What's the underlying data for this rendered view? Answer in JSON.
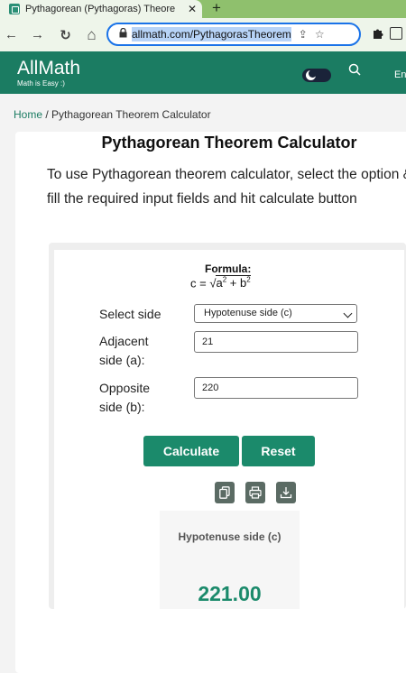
{
  "browser": {
    "tab_title": "Pythagorean (Pythagoras) Theore",
    "close_symbol": "✕",
    "newtab_symbol": "+",
    "url": "allmath.com/PythagorasTheorem",
    "nav": {
      "back": "←",
      "forward": "→",
      "reload": "↻",
      "home": "⌂"
    },
    "omnibox_icons": {
      "share": "⇪",
      "bookmark": "☆"
    },
    "extension_icon": "puzzle-icon"
  },
  "site": {
    "logo": "AllMath",
    "tagline": "Math is Easy :)",
    "lang": "En",
    "accent": "#1b7c62"
  },
  "breadcrumb": {
    "home": "Home",
    "separator": " / ",
    "current": "Pythagorean Theorem Calculator"
  },
  "card": {
    "title": "Pythagorean Theorem Calculator",
    "description": "To use Pythagorean theorem calculator, select the option & fill the required input fields and hit calculate button"
  },
  "calculator": {
    "formula_label": "Formula:",
    "formula": {
      "lhs": "c = ",
      "radical": "√",
      "a": "a",
      "plus": " + ",
      "b": "b",
      "sq": "2"
    },
    "select_label": "Select side",
    "select_value": "Hypotenuse side (c)",
    "adjacent_label_1": "Adjacent",
    "adjacent_label_2": "side (a):",
    "adjacent_value": "21",
    "opposite_label_1": "Opposite",
    "opposite_label_2": "side (b):",
    "opposite_value": "220",
    "calculate_label": "Calculate",
    "reset_label": "Reset",
    "result_label": "Hypotenuse side (c)",
    "result_value": "221.00",
    "button_color": "#1b8a6b"
  }
}
